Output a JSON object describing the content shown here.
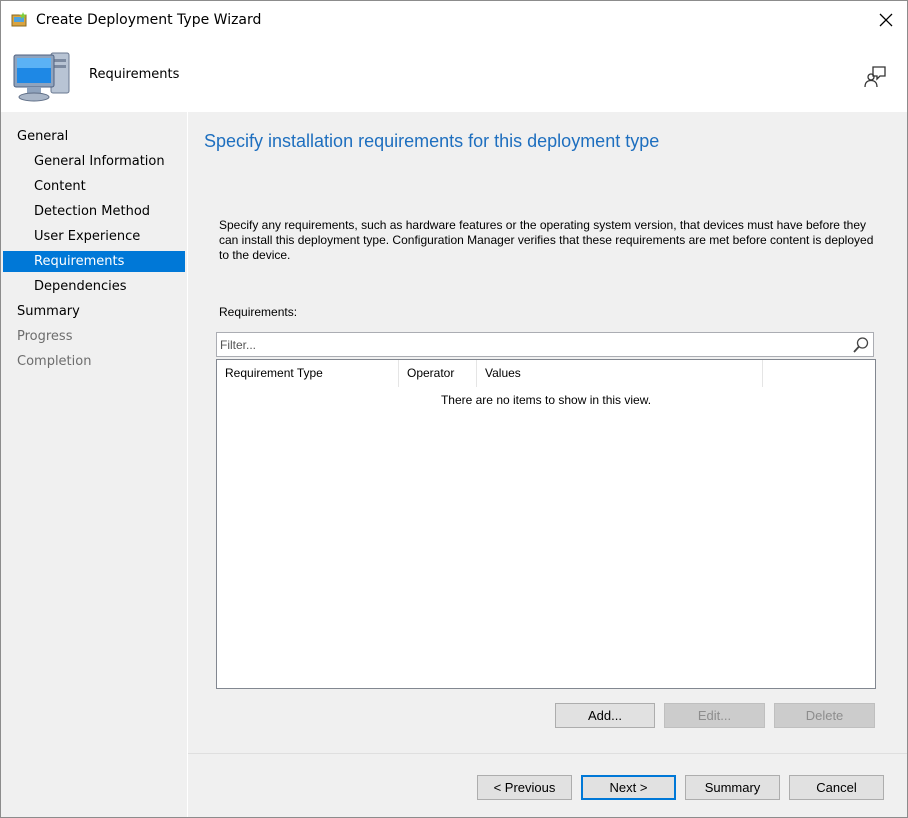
{
  "window": {
    "title": "Create Deployment Type Wizard"
  },
  "header": {
    "title": "Requirements"
  },
  "nav": {
    "items": [
      {
        "label": "General",
        "level": "top",
        "state": "normal"
      },
      {
        "label": "General Information",
        "level": "sub",
        "state": "normal"
      },
      {
        "label": "Content",
        "level": "sub",
        "state": "normal"
      },
      {
        "label": "Detection Method",
        "level": "sub",
        "state": "normal"
      },
      {
        "label": "User Experience",
        "level": "sub",
        "state": "normal"
      },
      {
        "label": "Requirements",
        "level": "sub",
        "state": "selected"
      },
      {
        "label": "Dependencies",
        "level": "sub",
        "state": "normal"
      },
      {
        "label": "Summary",
        "level": "top",
        "state": "normal"
      },
      {
        "label": "Progress",
        "level": "top",
        "state": "disabled"
      },
      {
        "label": "Completion",
        "level": "top",
        "state": "disabled"
      }
    ]
  },
  "main": {
    "heading": "Specify installation requirements for this deployment type",
    "description": "Specify any requirements, such as hardware features or the operating system version, that devices must have before they can install this deployment type. Configuration Manager verifies that these requirements are met before content is deployed to the device.",
    "requirements_label": "Requirements:",
    "filter": {
      "placeholder": "Filter...",
      "value": ""
    },
    "table": {
      "columns": [
        "Requirement Type",
        "Operator",
        "Values"
      ],
      "empty_message": "There are no items to show in this view."
    },
    "buttons": {
      "add": "Add...",
      "edit": "Edit...",
      "delete": "Delete"
    }
  },
  "footer": {
    "previous": "< Previous",
    "next": "Next >",
    "summary": "Summary",
    "cancel": "Cancel"
  },
  "colors": {
    "accent": "#0078d7",
    "heading": "#1e6fbf",
    "panel_bg": "#f0f0f0"
  }
}
